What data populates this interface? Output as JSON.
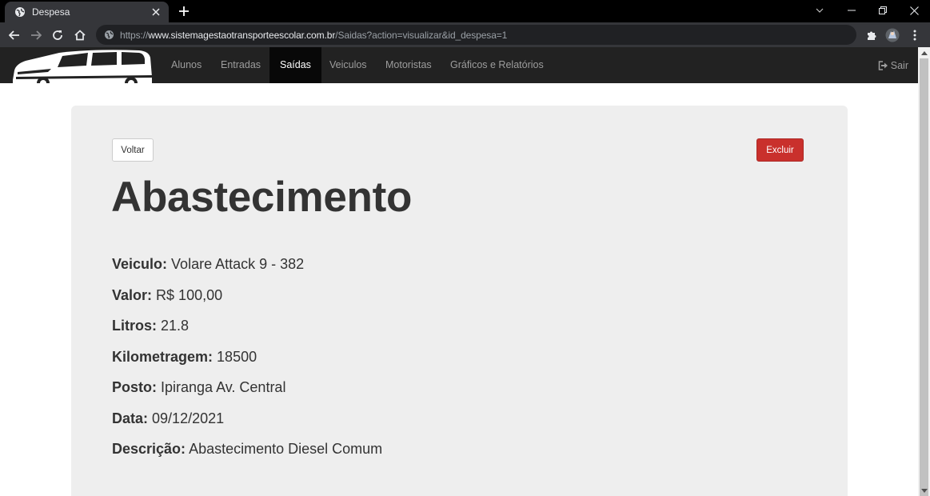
{
  "browser": {
    "tab_title": "Despesa",
    "url_scheme": "https://",
    "url_host": "www.sistemagestaotransporteescolar.com.br",
    "url_path": "/Saidas?action=visualizar&id_despesa=1"
  },
  "navbar": {
    "items": [
      {
        "label": "Alunos",
        "active": false
      },
      {
        "label": "Entradas",
        "active": false
      },
      {
        "label": "Saídas",
        "active": true
      },
      {
        "label": "Veiculos",
        "active": false
      },
      {
        "label": "Motoristas",
        "active": false
      },
      {
        "label": "Gráficos e Relatórios",
        "active": false
      }
    ],
    "logout_label": "Sair"
  },
  "actions": {
    "back_label": "Voltar",
    "delete_label": "Excluir"
  },
  "expense": {
    "title": "Abastecimento",
    "fields": [
      {
        "label": "Veiculo:",
        "value": "Volare Attack 9 - 382"
      },
      {
        "label": "Valor:",
        "value": "R$ 100,00"
      },
      {
        "label": "Litros:",
        "value": "21.8"
      },
      {
        "label": "Kilometragem:",
        "value": "18500"
      },
      {
        "label": "Posto:",
        "value": "Ipiranga Av. Central"
      },
      {
        "label": "Data:",
        "value": "09/12/2021"
      },
      {
        "label": "Descrição:",
        "value": "Abastecimento Diesel Comum"
      }
    ]
  },
  "colors": {
    "navbar_bg": "#222222",
    "navbar_active_bg": "#080808",
    "jumbotron_bg": "#eeeeee",
    "danger": "#c9302c",
    "text": "#333333"
  }
}
